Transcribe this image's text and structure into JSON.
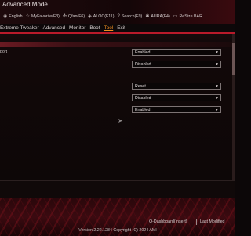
{
  "header": {
    "mode_title": "Advanced Mode",
    "quick_items": [
      {
        "icon": "globe-icon",
        "glyph": "◉",
        "label": "English"
      },
      {
        "icon": "star-icon",
        "glyph": "☆",
        "label": "MyFavorite(F3)"
      },
      {
        "icon": "fan-icon",
        "glyph": "✣",
        "label": "Qfan(F6)"
      },
      {
        "icon": "ai-icon",
        "glyph": "◈",
        "label": "AI OC(F11)"
      },
      {
        "icon": "help-icon",
        "glyph": "?",
        "label": "Search(F9)"
      },
      {
        "icon": "aura-icon",
        "glyph": "✱",
        "label": "AURA(F4)"
      },
      {
        "icon": "resize-bar-icon",
        "glyph": "▭",
        "label": "ReSize BAR"
      }
    ]
  },
  "menu": {
    "items": [
      "Extreme Tweaker",
      "Advanced",
      "Monitor",
      "Boot",
      "Tool",
      "Exit"
    ],
    "active": "Tool"
  },
  "rows": [
    {
      "label": "port",
      "value": "Enabled"
    },
    {
      "label": "",
      "value": "Disabled"
    },
    {
      "label": "",
      "value": "Reset"
    },
    {
      "label": "",
      "value": "Disabled"
    },
    {
      "label": "",
      "value": "Enabled"
    }
  ],
  "footer": {
    "qdashboard": "Q-Dashboard(Insert)",
    "last_modified": "Last Modified",
    "version": "Version 2.22.1284 Copyright (C) 2024 AMI"
  },
  "colors": {
    "accent_red": "#b81a2a",
    "active_tab": "#f08c20"
  }
}
